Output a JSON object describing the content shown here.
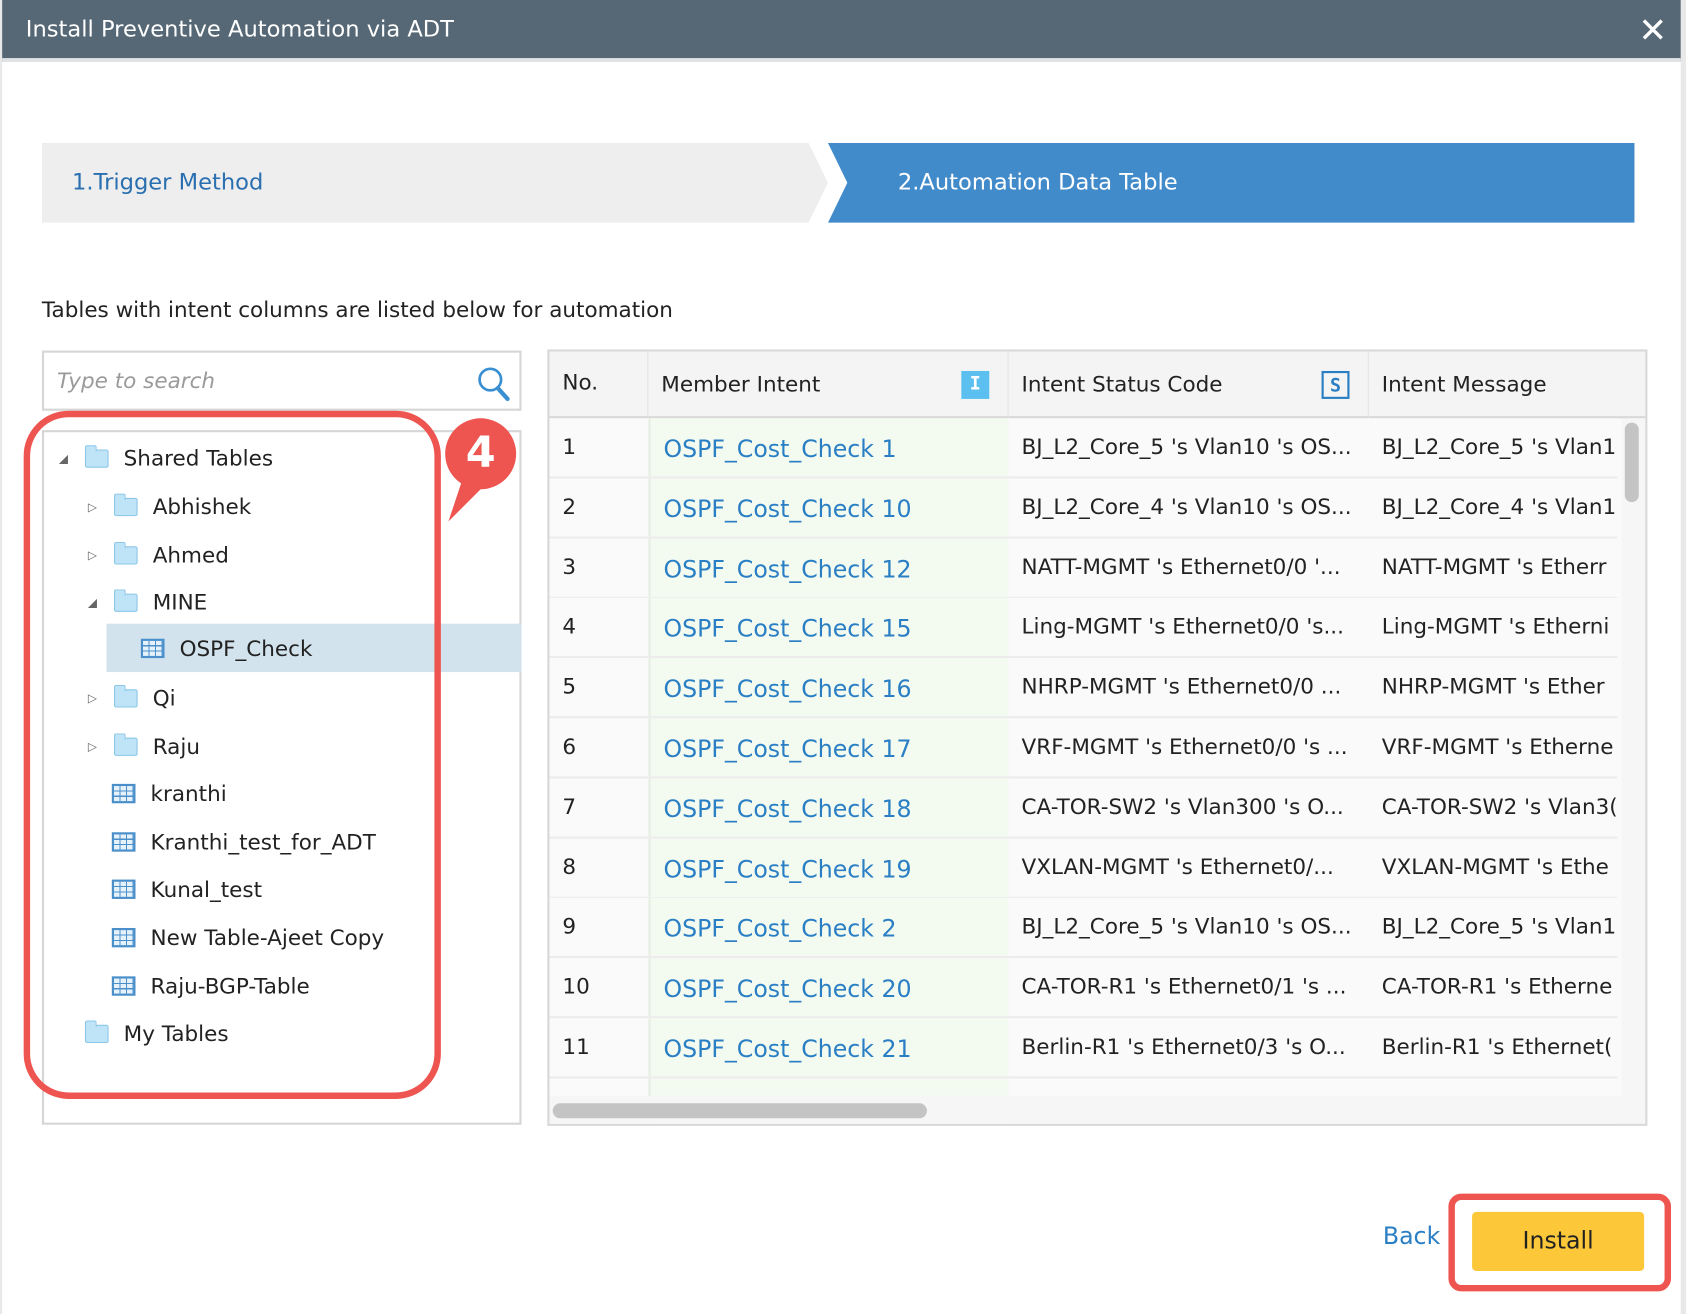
{
  "dialog": {
    "title": "Install Preventive Automation via ADT",
    "close_label": "✕"
  },
  "steps": [
    {
      "label": "1.Trigger Method",
      "active": false
    },
    {
      "label": "2.Automation Data Table",
      "active": true
    }
  ],
  "description": "Tables with intent columns are listed below for automation",
  "search": {
    "placeholder": "Type to search",
    "value": ""
  },
  "tree": {
    "root": "Shared Tables",
    "children": [
      "Abhishek",
      "Ahmed",
      "MINE",
      "Qi",
      "Raju",
      "kranthi",
      "Kranthi_test_for_ADT",
      "Kunal_test",
      "New Table-Ajeet Copy",
      "Raju-BGP-Table"
    ],
    "mine_child": "OSPF_Check",
    "my_tables": "My Tables"
  },
  "annotation": {
    "badge": "4",
    "color": "#ee5550"
  },
  "table": {
    "headers": [
      "No.",
      "Member Intent",
      "Intent Status Code",
      "Intent Message"
    ],
    "header_badges": [
      "I",
      "S"
    ],
    "rows": [
      [
        "1",
        "OSPF_Cost_Check 1",
        "BJ_L2_Core_5 's Vlan10 's OS...",
        "BJ_L2_Core_5 's Vlan1"
      ],
      [
        "2",
        "OSPF_Cost_Check 10",
        "BJ_L2_Core_4 's Vlan10 's OS...",
        "BJ_L2_Core_4 's Vlan1"
      ],
      [
        "3",
        "OSPF_Cost_Check 12",
        "NATT-MGMT 's Ethernet0/0 '...",
        "NATT-MGMT 's Etherr"
      ],
      [
        "4",
        "OSPF_Cost_Check 15",
        "Ling-MGMT 's Ethernet0/0 's...",
        "Ling-MGMT 's Etherni"
      ],
      [
        "5",
        "OSPF_Cost_Check 16",
        "NHRP-MGMT 's Ethernet0/0 ...",
        "NHRP-MGMT 's Ether"
      ],
      [
        "6",
        "OSPF_Cost_Check 17",
        "VRF-MGMT 's Ethernet0/0 's ...",
        "VRF-MGMT 's Etherne"
      ],
      [
        "7",
        "OSPF_Cost_Check 18",
        "CA-TOR-SW2 's Vlan300 's O...",
        "CA-TOR-SW2 's Vlan3("
      ],
      [
        "8",
        "OSPF_Cost_Check 19",
        "VXLAN-MGMT 's Ethernet0/...",
        "VXLAN-MGMT 's Ethe"
      ],
      [
        "9",
        "OSPF_Cost_Check 2",
        "BJ_L2_Core_5 's Vlan10 's OS...",
        "BJ_L2_Core_5 's Vlan1"
      ],
      [
        "10",
        "OSPF_Cost_Check 20",
        "CA-TOR-R1 's Ethernet0/1 's ...",
        "CA-TOR-R1 's Etherne"
      ],
      [
        "11",
        "OSPF_Cost_Check 21",
        "Berlin-R1 's Ethernet0/3 's O...",
        "Berlin-R1 's Ethernet("
      ]
    ]
  },
  "footer": {
    "back_label": "Back",
    "install_label": "Install"
  },
  "colors": {
    "titlebar": "#566875",
    "step_active": "#428bca",
    "link": "#2a7fc4",
    "install": "#fcc83a"
  }
}
